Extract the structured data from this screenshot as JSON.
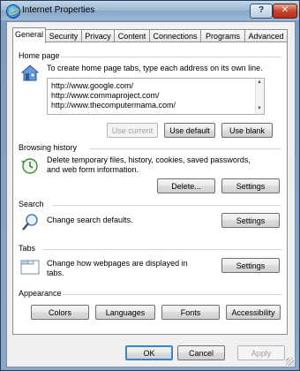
{
  "window": {
    "title": "Internet Properties",
    "help_label": "?",
    "close_label": "✕"
  },
  "tabs": [
    {
      "label": "General"
    },
    {
      "label": "Security"
    },
    {
      "label": "Privacy"
    },
    {
      "label": "Content"
    },
    {
      "label": "Connections"
    },
    {
      "label": "Programs"
    },
    {
      "label": "Advanced"
    }
  ],
  "home_page": {
    "title": "Home page",
    "description": "To create home page tabs, type each address on its own line.",
    "urls": [
      "http://www.google.com/",
      "http://www.commaproject.com/",
      "http://www.thecomputermama.com/"
    ],
    "buttons": {
      "use_current": "Use current",
      "use_default": "Use default",
      "use_blank": "Use blank"
    }
  },
  "browsing_history": {
    "title": "Browsing history",
    "description_line1": "Delete temporary files, history, cookies, saved passwords,",
    "description_line2": "and web form information.",
    "buttons": {
      "delete": "Delete...",
      "settings": "Settings"
    }
  },
  "search": {
    "title": "Search",
    "description": "Change search defaults.",
    "buttons": {
      "settings": "Settings"
    }
  },
  "tabs_section": {
    "title": "Tabs",
    "description_line1": "Change how webpages are displayed in",
    "description_line2": "tabs.",
    "buttons": {
      "settings": "Settings"
    }
  },
  "appearance": {
    "title": "Appearance",
    "buttons": {
      "colors": "Colors",
      "languages": "Languages",
      "fonts": "Fonts",
      "accessibility": "Accessibility"
    }
  },
  "dialog_buttons": {
    "ok": "OK",
    "cancel": "Cancel",
    "apply": "Apply"
  },
  "colors": {
    "title_bar": "#9ab6d3",
    "panel": "#f0f0f0",
    "focus": "#3b8ad9",
    "close": "#c7442a"
  }
}
